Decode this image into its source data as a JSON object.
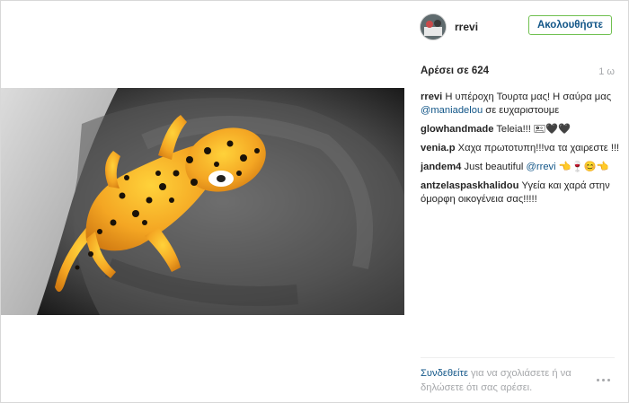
{
  "post": {
    "username": "rrevi",
    "follow_label": "Ακολουθήστε",
    "likes": "Αρέσει σε 624",
    "time": "1 ω",
    "photo_icon": "leopard-gecko-sculpture-photo"
  },
  "comments": [
    {
      "user": "rrevi",
      "text": " Η υπέροχη Τουρτα μας! Η σαύρα μας ",
      "mention": "@maniadelou",
      "after": " σε ευχαριστουμε"
    },
    {
      "user": "glowhandmade",
      "text": " Teleia!!! 🖭🖤🖤",
      "mention": "",
      "after": ""
    },
    {
      "user": "venia.p",
      "text": " Χαχα πρωτοτυπη!!!να τα χαιρεστε !!!",
      "mention": "",
      "after": ""
    },
    {
      "user": "jandem4",
      "text": " Just beautiful ",
      "mention": "@rrevi",
      "after": " 👈🍷😊👈"
    },
    {
      "user": "antzelaspaskhalidou",
      "text": " Υγεία και χαρά στην όμορφη οικογένεια σας!!!!!",
      "mention": "",
      "after": ""
    }
  ],
  "footer": {
    "login_link": "Συνδεθείτε",
    "prompt": " για να σχολιάσετε ή να δηλώσετε ότι σας αρέσει."
  },
  "colors": {
    "link": "#125688",
    "muted": "#a5a7aa",
    "follow_border": "#70c050"
  }
}
